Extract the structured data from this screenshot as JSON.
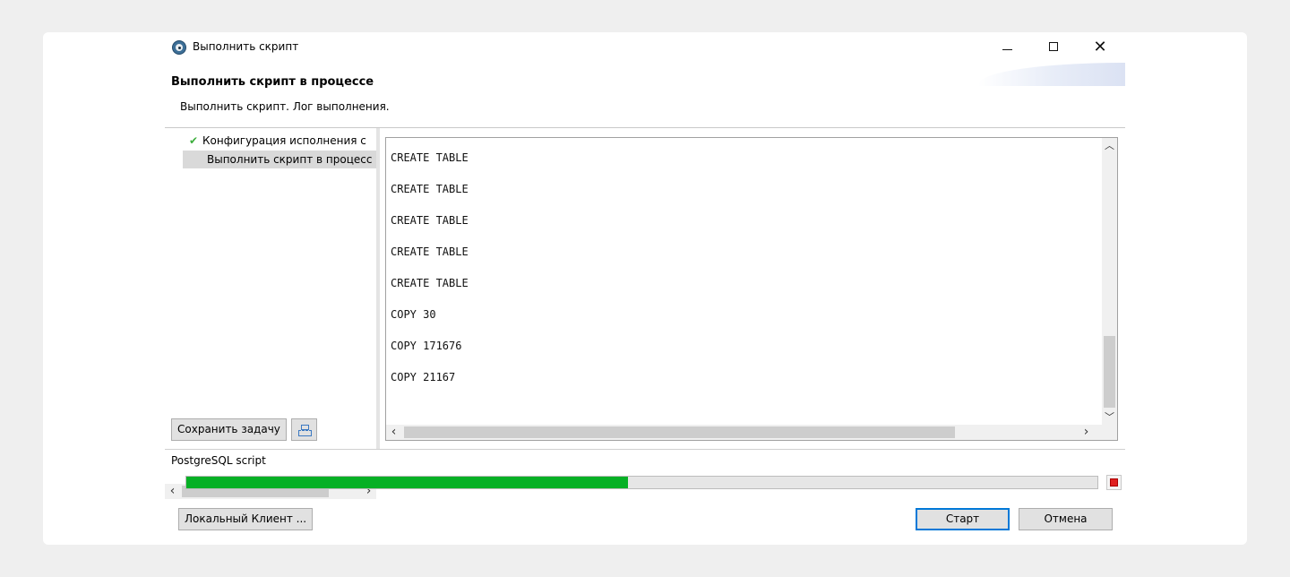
{
  "window": {
    "title": "Выполнить скрипт",
    "icon": "dbeaver-app-icon"
  },
  "header": {
    "title": "Выполнить скрипт в процессе",
    "description": "Выполнить скрипт. Лог выполнения."
  },
  "nav": {
    "items": [
      {
        "label": "Конфигурация исполнения с",
        "icon": "check-icon",
        "selected": false
      },
      {
        "label": "Выполнить скрипт в процесс",
        "selected": true
      }
    ]
  },
  "log": {
    "lines": [
      "CREATE TABLE",
      "CREATE TABLE",
      "CREATE TABLE",
      "CREATE TABLE",
      "CREATE TABLE",
      "COPY 30",
      "COPY 171676",
      "COPY 21167"
    ]
  },
  "toolbar": {
    "save_task_label": "Сохранить задачу",
    "task_tool_icon": "task-tree-icon"
  },
  "progress": {
    "task_name": "PostgreSQL script",
    "fraction": 0.485,
    "color": "#06b025"
  },
  "footer": {
    "local_client_label": "Локальный Клиент ...",
    "start_label": "Старт",
    "cancel_label": "Отмена"
  },
  "colors": {
    "accent": "#0078d7",
    "check": "#3cae3c",
    "stop": "#e02020"
  }
}
